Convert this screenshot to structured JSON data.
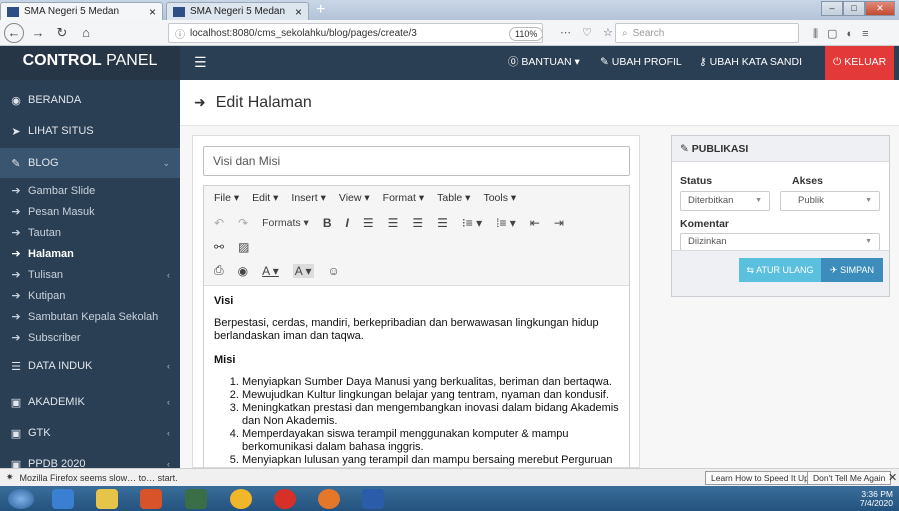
{
  "browser": {
    "tabs": [
      {
        "label": "SMA Negeri 5 Medan"
      },
      {
        "label": "SMA Negeri 5 Medan"
      }
    ],
    "url": "localhost:8080/cms_sekolahku/blog/pages/create/3",
    "zoom": "110%",
    "search_placeholder": "Search",
    "status_text": "Mozilla Firefox seems slow… to… start.",
    "notif_learn": "Learn How to Speed It Up",
    "notif_dismiss": "Don't Tell Me Again",
    "clock_time": "3:36 PM",
    "clock_date": "7/4/2020"
  },
  "header": {
    "brand_bold": "CONTROL",
    "brand_rest": " PANEL",
    "menu": {
      "bantuan": "BANTUAN",
      "ubah_profil": "UBAH PROFIL",
      "ubah_kata_sandi": "UBAH KATA SANDI",
      "keluar": "KELUAR"
    }
  },
  "sidebar": {
    "beranda": "BERANDA",
    "lihat_situs": "LIHAT SITUS",
    "blog": "BLOG",
    "blog_items": [
      "Gambar Slide",
      "Pesan Masuk",
      "Tautan",
      "Halaman",
      "Tulisan",
      "Kutipan",
      "Sambutan Kepala Sekolah",
      "Subscriber"
    ],
    "data_induk": "DATA INDUK",
    "akademik": "AKADEMIK",
    "gtk": "GTK",
    "ppdb": "PPDB 2020"
  },
  "page": {
    "title": "Edit Halaman",
    "post_title_value": "Visi dan Misi"
  },
  "editor": {
    "menu": [
      "File",
      "Edit",
      "Insert",
      "View",
      "Format",
      "Table",
      "Tools"
    ],
    "formats": "Formats",
    "content": {
      "h1": "Visi",
      "p1": "Berpestasi, cerdas, mandiri, berkepribadian dan berwawasan lingkungan hidup berlandaskan iman dan taqwa.",
      "h2": "Misi",
      "items": [
        "Menyiapkan Sumber Daya Manusi yang berkualitas, beriman dan bertaqwa.",
        "Mewujudkan Kultur lingkungan belajar yang tentram, nyaman dan kondusif.",
        "Meningkatkan prestasi dan mengembangkan inovasi dalam bidang Akademis dan Non Akademis.",
        "Memperdayakan siswa terampil menggunakan komputer & mampu berkomunikasi dalam bahasa inggris.",
        "Menyiapkan lulusan yang terampil dan mampu bersaing merebut Perguruan Tinggi favorit baik nasional dan internasional."
      ]
    }
  },
  "publish": {
    "title": "PUBLIKASI",
    "status_label": "Status",
    "status_value": "Diterbitkan",
    "access_label": "Akses",
    "access_value": "Publik",
    "comment_label": "Komentar",
    "comment_value": "Diizinkan",
    "reset_label": "ATUR ULANG",
    "save_label": "SIMPAN"
  },
  "colors": {
    "header_bg": "#2a3f54",
    "logout_red": "#e33939",
    "reset_blue": "#5bc0de",
    "save_blue": "#3c8dbc"
  }
}
